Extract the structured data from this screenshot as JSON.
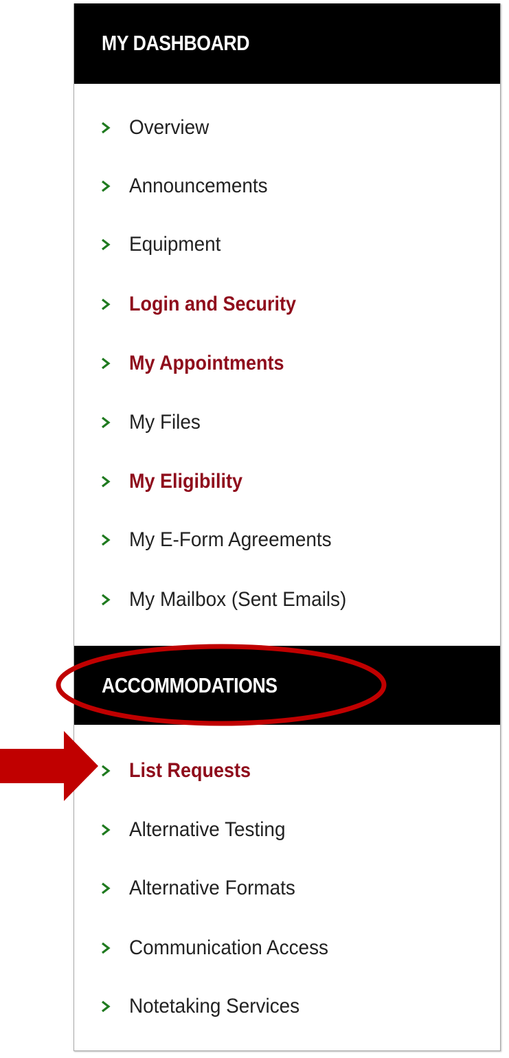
{
  "sections": [
    {
      "title": "MY DASHBOARD",
      "items": [
        {
          "label": "Overview",
          "highlighted": false
        },
        {
          "label": "Announcements",
          "highlighted": false
        },
        {
          "label": "Equipment",
          "highlighted": false
        },
        {
          "label": "Login and Security",
          "highlighted": true
        },
        {
          "label": "My Appointments",
          "highlighted": true
        },
        {
          "label": "My Files",
          "highlighted": false
        },
        {
          "label": "My Eligibility",
          "highlighted": true
        },
        {
          "label": "My E-Form Agreements",
          "highlighted": false
        },
        {
          "label": "My Mailbox (Sent Emails)",
          "highlighted": false
        }
      ]
    },
    {
      "title": "ACCOMMODATIONS",
      "items": [
        {
          "label": "List Requests",
          "highlighted": true
        },
        {
          "label": "Alternative Testing",
          "highlighted": false
        },
        {
          "label": "Alternative Formats",
          "highlighted": false
        },
        {
          "label": "Communication Access",
          "highlighted": false
        },
        {
          "label": "Notetaking Services",
          "highlighted": false
        }
      ]
    }
  ],
  "annotations": {
    "circled_item": "ACCOMMODATIONS",
    "arrow_target": "List Requests"
  },
  "colors": {
    "header_bg": "#000000",
    "header_text": "#ffffff",
    "chevron": "#1f7a1f",
    "highlight_text": "#8f0d1c",
    "normal_text": "#222222",
    "annotation_red": "#c00000"
  }
}
